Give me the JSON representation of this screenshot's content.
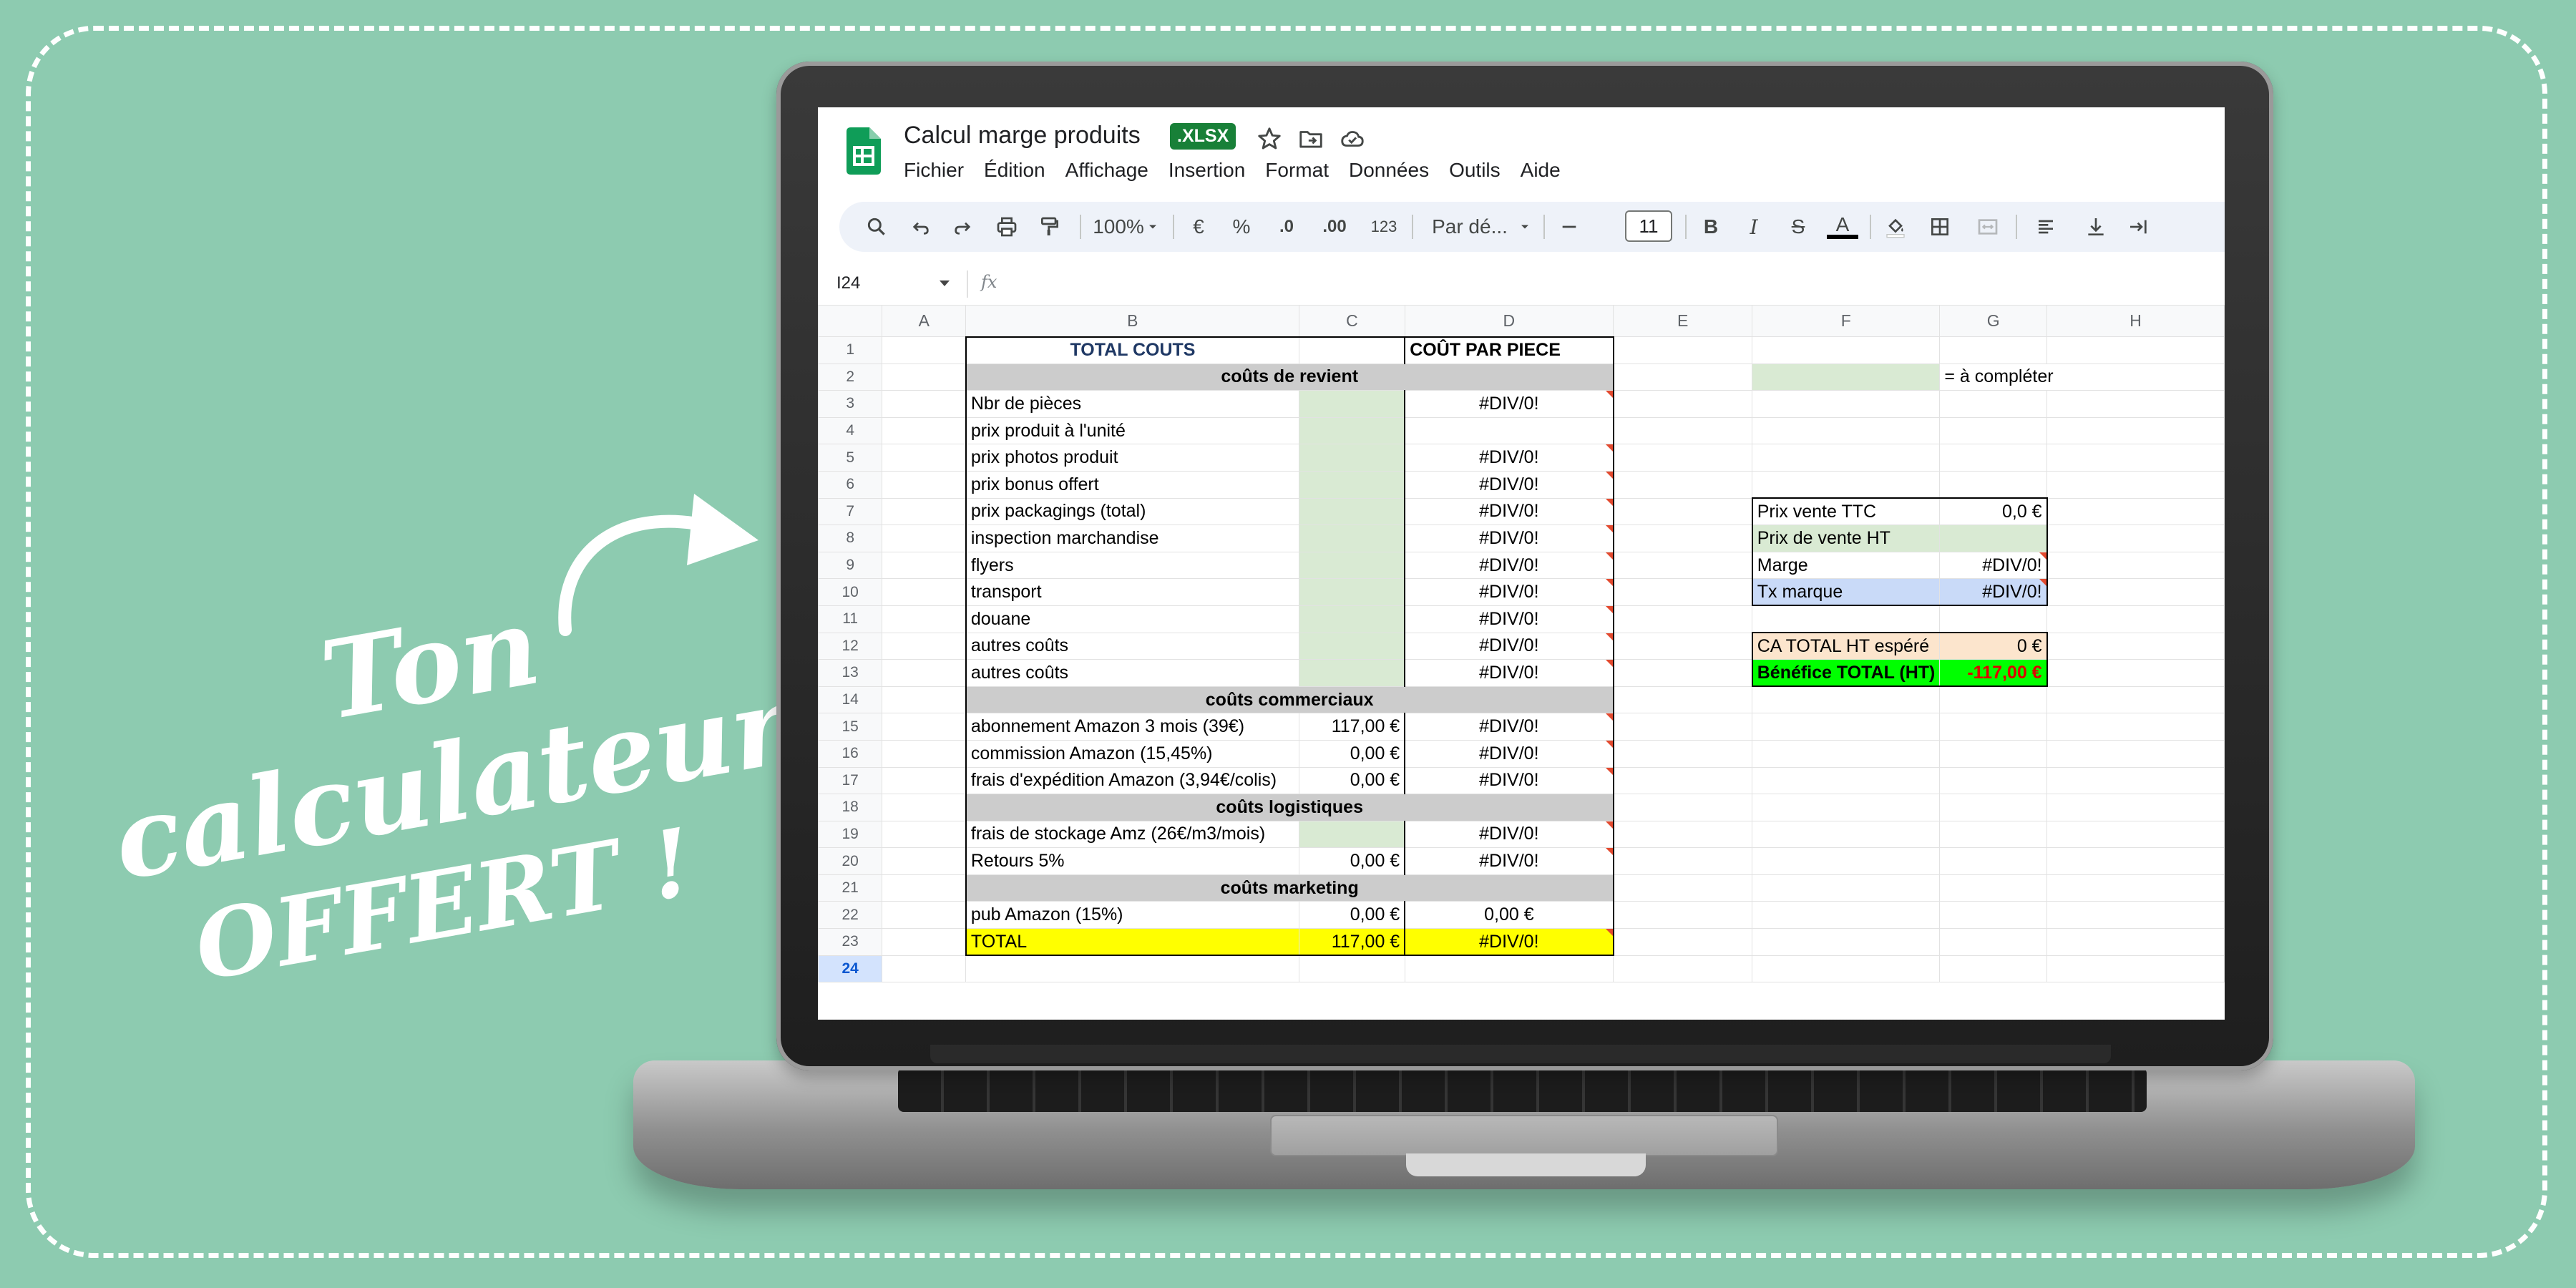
{
  "promo": {
    "line1": "Ton calculateur",
    "line2": "OFFERT !"
  },
  "app": {
    "title": "Calcul marge produits",
    "badge": ".XLSX",
    "menu": [
      "Fichier",
      "Édition",
      "Affichage",
      "Insertion",
      "Format",
      "Données",
      "Outils",
      "Aide"
    ]
  },
  "toolbar": {
    "zoom": "100%",
    "currency": "€",
    "percent": "%",
    "dec_less": ".0",
    "dec_more": ".00",
    "num_format": "123",
    "font": "Par dé...",
    "font_size": "11",
    "bold": "B",
    "italic": "I",
    "strike": "S",
    "text_color": "A"
  },
  "formula_bar": {
    "cell_ref": "I24",
    "fx": "fx"
  },
  "columns": [
    "A",
    "B",
    "C",
    "D",
    "E",
    "F",
    "G",
    "H"
  ],
  "rows": [
    "1",
    "2",
    "3",
    "4",
    "5",
    "6",
    "7",
    "8",
    "9",
    "10",
    "11",
    "12",
    "13",
    "14",
    "15",
    "16",
    "17",
    "18",
    "19",
    "20",
    "21",
    "22",
    "23",
    "24"
  ],
  "sheet": {
    "header_total": "TOTAL COUTS",
    "header_piece": "COÛT PAR PIECE",
    "sec_revient": "coûts de revient",
    "sec_commerciaux": "coûts commerciaux",
    "sec_logistiques": "coûts logistiques",
    "sec_marketing": "coûts marketing",
    "legend": "= à compléter",
    "items": [
      {
        "label": "Nbr de pièces",
        "c": "",
        "d": "#DIV/0!"
      },
      {
        "label": "prix produit à l'unité",
        "c": "",
        "d": ""
      },
      {
        "label": "prix photos produit",
        "c": "",
        "d": "#DIV/0!"
      },
      {
        "label": "prix bonus offert",
        "c": "",
        "d": "#DIV/0!"
      },
      {
        "label": "prix packagings (total)",
        "c": "",
        "d": "#DIV/0!"
      },
      {
        "label": "inspection marchandise",
        "c": "",
        "d": "#DIV/0!"
      },
      {
        "label": "flyers",
        "c": "",
        "d": "#DIV/0!"
      },
      {
        "label": "transport",
        "c": "",
        "d": "#DIV/0!"
      },
      {
        "label": "douane",
        "c": "",
        "d": "#DIV/0!"
      },
      {
        "label": "autres coûts",
        "c": "",
        "d": "#DIV/0!"
      },
      {
        "label": "autres coûts",
        "c": "",
        "d": "#DIV/0!"
      },
      {
        "label": "abonnement Amazon 3 mois (39€)",
        "c": "117,00 €",
        "d": "#DIV/0!"
      },
      {
        "label": "commission Amazon (15,45%)",
        "c": "0,00 €",
        "d": "#DIV/0!"
      },
      {
        "label": "frais d'expédition Amazon (3,94€/colis)",
        "c": "0,00 €",
        "d": "#DIV/0!"
      },
      {
        "label": "frais de stockage Amz (26€/m3/mois)",
        "c": "",
        "d": "#DIV/0!"
      },
      {
        "label": "Retours 5%",
        "c": "0,00 €",
        "d": "#DIV/0!"
      },
      {
        "label": "pub Amazon (15%)",
        "c": "0,00 €",
        "d": "0,00 €"
      },
      {
        "label": "TOTAL",
        "c": "117,00 €",
        "d": "#DIV/0!"
      }
    ],
    "side": {
      "prix_ttc_label": "Prix vente TTC",
      "prix_ttc_value": "0,0 €",
      "prix_ht_label": "Prix de vente HT",
      "prix_ht_value": "",
      "marge_label": "Marge",
      "marge_value": "#DIV/0!",
      "tx_label": "Tx marque",
      "tx_value": "#DIV/0!",
      "ca_label": "CA TOTAL HT espéré",
      "ca_value": "0 €",
      "benef_label": "Bénéfice TOTAL (HT)",
      "benef_value": "-117,00 €"
    }
  },
  "colors": {
    "background": "#8dcbb0",
    "input_green": "#d9ead3",
    "section_gray": "#cccccc",
    "total_yellow": "#ffff00",
    "profit_lime": "#00ff00",
    "loss_red": "#e00000",
    "xlsx_badge": "#188038"
  }
}
